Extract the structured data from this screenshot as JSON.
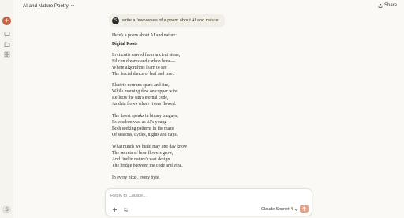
{
  "colors": {
    "accent": "#c96442",
    "background": "#faf9f5",
    "sidebar": "#f5f4ee",
    "send_button": "#e3a48d"
  },
  "sidebar": {
    "icons": [
      "new-chat-icon",
      "chats-icon",
      "projects-icon",
      "artifacts-icon"
    ],
    "user_initial": "S"
  },
  "header": {
    "title": "AI and Nature Poetry",
    "share_label": "Share"
  },
  "user_message": {
    "avatar_initial": "S",
    "text": "write a few verses of a poem about AI and nature"
  },
  "response": {
    "intro": "Here's a poem about AI and nature:",
    "poem_title": "Digital Roots",
    "stanzas": [
      [
        "In circuits carved from ancient stone,",
        "Silicon dreams and carbon bone—",
        "Where algorithms learn to see",
        "The fractal dance of leaf and tree."
      ],
      [
        "Electric neurons spark and fire,",
        "While morning dew on copper wire",
        "Reflects the sun's eternal code,",
        "As data flows where rivers flowed."
      ],
      [
        "The forest speaks in binary tongues,",
        "Its wisdom vast as AI's young—",
        "Both seeking patterns in the maze",
        "Of seasons, cycles, nights and days."
      ],
      [
        "What minds we build may one day know",
        "The secrets of how flowers grow,",
        "And find in nature's vast design",
        "The bridge between the code and vine."
      ],
      [
        "In every pixel, every byte,"
      ]
    ]
  },
  "composer": {
    "placeholder": "Reply to Claude...",
    "model_label": "Claude Sonnet 4"
  }
}
